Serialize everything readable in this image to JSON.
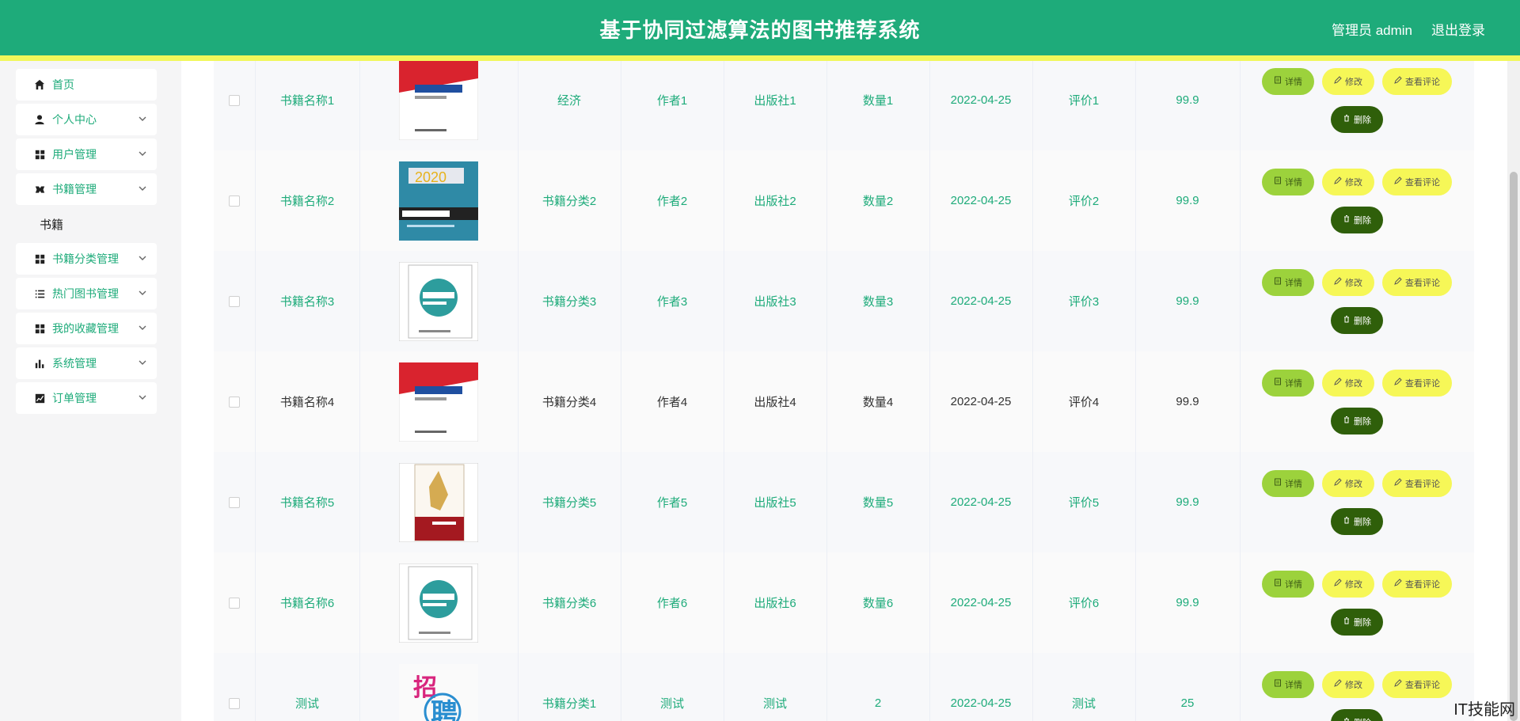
{
  "header": {
    "title": "基于协同过滤算法的图书推荐系统",
    "admin": "管理员 admin",
    "logout": "退出登录"
  },
  "sidebar": {
    "items": [
      {
        "label": "首页",
        "icon": "home-icon",
        "expandable": false
      },
      {
        "label": "个人中心",
        "icon": "user-icon",
        "expandable": true
      },
      {
        "label": "用户管理",
        "icon": "grid-icon",
        "expandable": true
      },
      {
        "label": "书籍管理",
        "icon": "book-icon",
        "expandable": true
      },
      {
        "label": "书籍分类管理",
        "icon": "grid-icon",
        "expandable": true
      },
      {
        "label": "热门图书管理",
        "icon": "list-icon",
        "expandable": true
      },
      {
        "label": "我的收藏管理",
        "icon": "grid-icon",
        "expandable": true
      },
      {
        "label": "系统管理",
        "icon": "bar-chart-icon",
        "expandable": true
      },
      {
        "label": "订单管理",
        "icon": "trend-icon",
        "expandable": true
      }
    ],
    "sub_item": "书籍"
  },
  "buttons": {
    "detail": "详情",
    "edit": "修改",
    "review": "查看评论",
    "delete": "删除"
  },
  "table": {
    "rows": [
      {
        "name": "书籍名称1",
        "category": "经济",
        "author": "作者1",
        "publisher": "出版社1",
        "quantity": "数量1",
        "date": "2022-04-25",
        "rating": "评价1",
        "price": "99.9",
        "cover": "red"
      },
      {
        "name": "书籍名称2",
        "category": "书籍分类2",
        "author": "作者2",
        "publisher": "出版社2",
        "quantity": "数量2",
        "date": "2022-04-25",
        "rating": "评价2",
        "price": "99.9",
        "cover": "teal"
      },
      {
        "name": "书籍名称3",
        "category": "书籍分类3",
        "author": "作者3",
        "publisher": "出版社3",
        "quantity": "数量3",
        "date": "2022-04-25",
        "rating": "评价3",
        "price": "99.9",
        "cover": "white"
      },
      {
        "name": "书籍名称4",
        "category": "书籍分类4",
        "author": "作者4",
        "publisher": "出版社4",
        "quantity": "数量4",
        "date": "2022-04-25",
        "rating": "评价4",
        "price": "99.9",
        "cover": "red"
      },
      {
        "name": "书籍名称5",
        "category": "书籍分类5",
        "author": "作者5",
        "publisher": "出版社5",
        "quantity": "数量5",
        "date": "2022-04-25",
        "rating": "评价5",
        "price": "99.9",
        "cover": "gold"
      },
      {
        "name": "书籍名称6",
        "category": "书籍分类6",
        "author": "作者6",
        "publisher": "出版社6",
        "quantity": "数量6",
        "date": "2022-04-25",
        "rating": "评价6",
        "price": "99.9",
        "cover": "white"
      },
      {
        "name": "测试",
        "category": "书籍分类1",
        "author": "测试",
        "publisher": "测试",
        "quantity": "2",
        "date": "2022-04-25",
        "rating": "测试",
        "price": "25",
        "cover": "logo"
      }
    ]
  },
  "watermark": "IT技能网",
  "colors": {
    "primary": "#1eab7a",
    "strip": "#f1f75a",
    "detail_btn": "#9cd23c",
    "edit_btn": "#f6f757",
    "delete_btn": "#2f5f0a"
  }
}
